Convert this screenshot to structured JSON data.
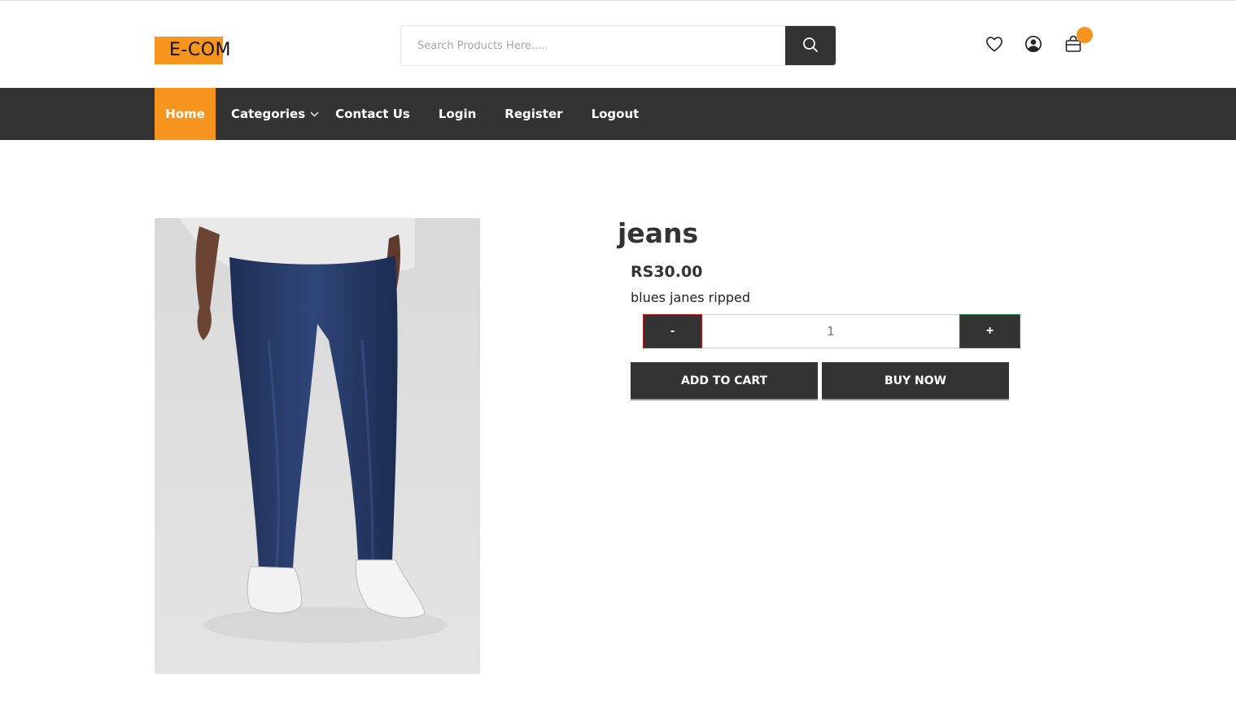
{
  "header": {
    "logo_text": "E-COM",
    "search_placeholder": "Search Products Here.....",
    "icons": [
      "search-icon",
      "heart-icon",
      "user-circle-icon",
      "cart-icon"
    ],
    "cart_count": ""
  },
  "nav": {
    "items": [
      {
        "label": "Home",
        "active": true
      },
      {
        "label": "Categories",
        "has_dropdown": true
      },
      {
        "label": "Contact Us"
      },
      {
        "label": "Login"
      },
      {
        "label": "Register"
      },
      {
        "label": "Logout"
      }
    ]
  },
  "product": {
    "title": "jeans",
    "price": "RS30.00",
    "description": "blues janes ripped",
    "quantity": "1",
    "minus_label": "-",
    "plus_label": "+",
    "add_to_cart_label": "ADD TO CART",
    "buy_now_label": "BUY NOW"
  },
  "colors": {
    "accent": "#f7941d",
    "dark": "#333333",
    "minus_border": "#b91c1c",
    "plus_border": "#15803d"
  }
}
